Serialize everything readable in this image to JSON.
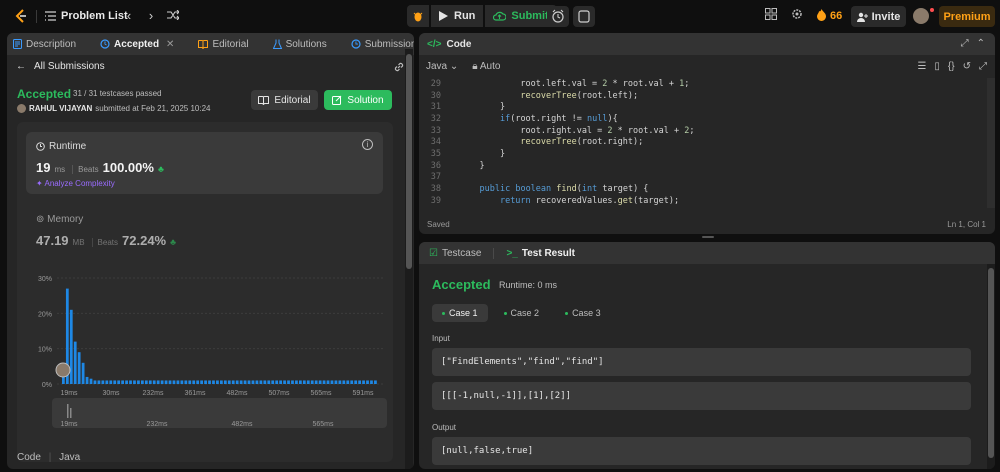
{
  "topbar": {
    "problem_list": "Problem List",
    "run": "Run",
    "submit": "Submit",
    "streak": "66",
    "invite": "Invite",
    "premium": "Premium"
  },
  "left": {
    "tabs": [
      {
        "label": "Description",
        "icon": "description-icon"
      },
      {
        "label": "Accepted",
        "icon": "history-icon",
        "active": true
      },
      {
        "label": "Editorial",
        "icon": "book-icon"
      },
      {
        "label": "Solutions",
        "icon": "flask-icon"
      },
      {
        "label": "Submissions",
        "icon": "clock-icon"
      }
    ],
    "all_submissions": "All Submissions",
    "status": "Accepted",
    "passed": "31 / 31 testcases passed",
    "author": "RAHUL VIJAYAN",
    "submitted_at": "submitted at Feb 21, 2025 10:24",
    "editorial_btn": "Editorial",
    "solution_btn": "Solution",
    "runtime": {
      "label": "Runtime",
      "value": "19",
      "unit": "ms",
      "beats_label": "Beats",
      "beats": "100.00%",
      "analyze": "Analyze Complexity"
    },
    "memory": {
      "label": "Memory",
      "value": "47.19",
      "unit": "MB",
      "beats_label": "Beats",
      "beats": "72.24%"
    },
    "code_label": "Code",
    "code_lang": "Java"
  },
  "chart_data": {
    "type": "bar",
    "yticks": [
      "0%",
      "10%",
      "20%",
      "30%"
    ],
    "ylim": [
      0,
      30
    ],
    "xticks": [
      "19ms",
      "30ms",
      "232ms",
      "361ms",
      "482ms",
      "507ms",
      "565ms",
      "591ms"
    ],
    "values": [
      4,
      27,
      21,
      12,
      9,
      6,
      2,
      1.5,
      1,
      1,
      1,
      1,
      1,
      1,
      1,
      1,
      1,
      1,
      1,
      1,
      1,
      1,
      1,
      1,
      1,
      1,
      1,
      1,
      1,
      1,
      1,
      1,
      1,
      1,
      1,
      1,
      1,
      1,
      1,
      1,
      1,
      1,
      1,
      1,
      1,
      1,
      1,
      1,
      1,
      1,
      1,
      1,
      1,
      1,
      1,
      1,
      1,
      1,
      1,
      1,
      1,
      1,
      1,
      1,
      1,
      1,
      1,
      1,
      1,
      1,
      1,
      1,
      1,
      1,
      1,
      1,
      1,
      1,
      1,
      1
    ],
    "highlight_index": 0,
    "overview_ticks": [
      "19ms",
      "232ms",
      "482ms",
      "565ms"
    ],
    "color": "#1e88e5"
  },
  "code": {
    "title": "Code",
    "lang": "Java",
    "mode": "Auto",
    "saved": "Saved",
    "position": "Ln 1, Col 1",
    "lines": [
      {
        "n": "29",
        "t": "            root.left.val = 2 * root.val + 1;"
      },
      {
        "n": "30",
        "t": "            recoverTree(root.left);"
      },
      {
        "n": "31",
        "t": "        }"
      },
      {
        "n": "32",
        "t": "        if(root.right != null){"
      },
      {
        "n": "33",
        "t": "            root.right.val = 2 * root.val + 2;"
      },
      {
        "n": "34",
        "t": "            recoverTree(root.right);"
      },
      {
        "n": "35",
        "t": "        }"
      },
      {
        "n": "36",
        "t": "    }"
      },
      {
        "n": "37",
        "t": ""
      },
      {
        "n": "38",
        "t": "    public boolean find(int target) {"
      },
      {
        "n": "39",
        "t": "        return recoveredValues.get(target);"
      }
    ]
  },
  "result": {
    "tab_testcase": "Testcase",
    "tab_result": "Test Result",
    "status": "Accepted",
    "runtime": "Runtime: 0 ms",
    "cases": [
      "Case 1",
      "Case 2",
      "Case 3"
    ],
    "input_label": "Input",
    "input1": "[\"FindElements\",\"find\",\"find\"]",
    "input2": "[[[-1,null,-1]],[1],[2]]",
    "output_label": "Output",
    "output": "[null,false,true]"
  }
}
